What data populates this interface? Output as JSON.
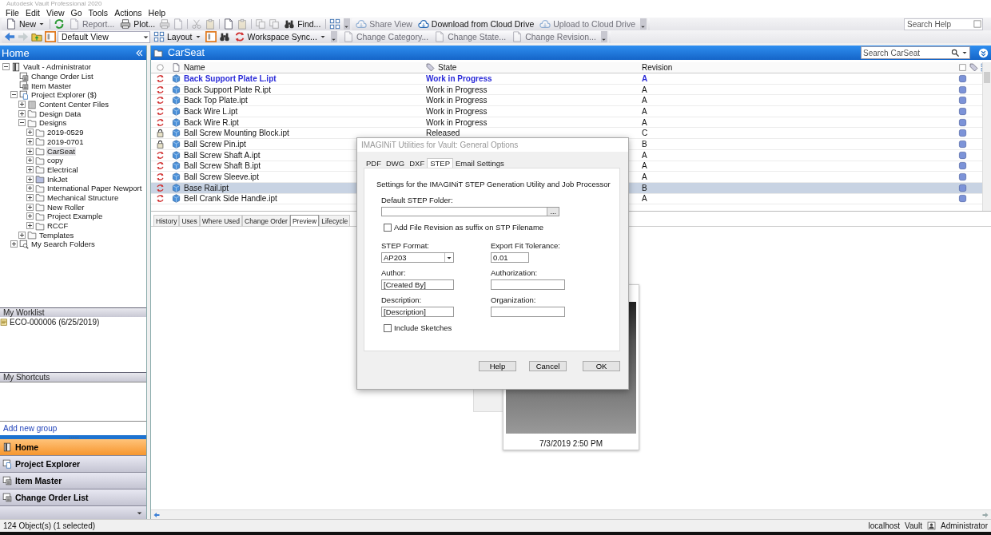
{
  "window": {
    "title": "Autodesk Vault Professional 2020"
  },
  "menu": [
    "File",
    "Edit",
    "View",
    "Go",
    "Tools",
    "Actions",
    "Help"
  ],
  "toolbar_1": [
    {
      "kind": "button",
      "label": "New",
      "dropdown": true,
      "disabled": false
    },
    {
      "kind": "sep"
    },
    {
      "kind": "icon",
      "disabled": false
    },
    {
      "kind": "button",
      "label": "Report...",
      "disabled": true
    },
    {
      "kind": "button",
      "label": "Plot...",
      "disabled": false
    },
    {
      "kind": "icon",
      "disabled": true
    },
    {
      "kind": "icon",
      "disabled": true
    },
    {
      "kind": "sep"
    },
    {
      "kind": "icon",
      "disabled": true
    },
    {
      "kind": "icon",
      "disabled": true
    },
    {
      "kind": "sep"
    },
    {
      "kind": "icon",
      "disabled": false
    },
    {
      "kind": "icon",
      "disabled": true
    },
    {
      "kind": "sep"
    },
    {
      "kind": "icon",
      "disabled": true
    },
    {
      "kind": "icon",
      "disabled": true
    },
    {
      "kind": "button",
      "label": "Find...",
      "disabled": false
    },
    {
      "kind": "sep"
    },
    {
      "kind": "icon",
      "disabled": false
    },
    {
      "kind": "end"
    },
    {
      "kind": "button",
      "label": "Share View",
      "disabled": true
    },
    {
      "kind": "button",
      "label": "Download from Cloud Drive",
      "disabled": false
    },
    {
      "kind": "button",
      "label": "Upload to Cloud Drive",
      "disabled": true
    },
    {
      "kind": "end"
    }
  ],
  "search_help": {
    "placeholder": "Search Help"
  },
  "toolbar_2": [
    {
      "kind": "icon",
      "disabled": false
    },
    {
      "kind": "icon",
      "disabled": true
    },
    {
      "kind": "icon",
      "disabled": false
    },
    {
      "kind": "icon",
      "disabled": false
    },
    {
      "kind": "combo",
      "label": "Default View"
    },
    {
      "kind": "button",
      "label": "Layout",
      "dropdown": true,
      "disabled": false
    },
    {
      "kind": "icon",
      "disabled": false
    },
    {
      "kind": "icon",
      "disabled": false
    },
    {
      "kind": "button",
      "label": "Workspace Sync...",
      "dropdown": true,
      "disabled": false
    },
    {
      "kind": "end"
    },
    {
      "kind": "button",
      "label": "Change Category...",
      "disabled": true
    },
    {
      "kind": "button",
      "label": "Change State...",
      "disabled": true
    },
    {
      "kind": "button",
      "label": "Change Revision...",
      "disabled": true
    },
    {
      "kind": "end"
    }
  ],
  "left_panel": {
    "title": "Home",
    "tree": [
      {
        "label": "Vault - Administrator",
        "expanded": true,
        "selected": false,
        "children": [
          {
            "label": "Change Order List",
            "selected": false
          },
          {
            "label": "Item Master",
            "selected": false
          },
          {
            "label": "Project Explorer ($)",
            "expanded": true,
            "selected": false,
            "children": [
              {
                "label": "Content Center Files",
                "expanded": false,
                "selected": false
              },
              {
                "label": "Design Data",
                "expanded": false,
                "selected": false
              },
              {
                "label": "Designs",
                "expanded": true,
                "selected": false,
                "children": [
                  {
                    "label": "2019-0529",
                    "expanded": false,
                    "selected": false
                  },
                  {
                    "label": "2019-0701",
                    "expanded": false,
                    "selected": false
                  },
                  {
                    "label": "CarSeat",
                    "expanded": false,
                    "selected": true
                  },
                  {
                    "label": "copy",
                    "expanded": false,
                    "selected": false
                  },
                  {
                    "label": "Electrical",
                    "expanded": false,
                    "selected": false
                  },
                  {
                    "label": "InkJet",
                    "expanded": false,
                    "selected": false
                  },
                  {
                    "label": "International Paper Newport",
                    "expanded": false,
                    "selected": false
                  },
                  {
                    "label": "Mechanical Structure",
                    "expanded": false,
                    "selected": false
                  },
                  {
                    "label": "New Roller",
                    "expanded": false,
                    "selected": false
                  },
                  {
                    "label": "Project Example",
                    "expanded": false,
                    "selected": false
                  },
                  {
                    "label": "RCCF",
                    "expanded": false,
                    "selected": false
                  }
                ]
              },
              {
                "label": "Templates",
                "expanded": false,
                "selected": false
              }
            ]
          },
          {
            "label": "My Search Folders",
            "expanded": false,
            "selected": false
          }
        ]
      }
    ],
    "worklist": {
      "title": "My Worklist",
      "items": [
        "ECO-000006 (6/25/2019)"
      ]
    },
    "shortcuts": {
      "title": "My Shortcuts",
      "action": "Add new group"
    },
    "nav": [
      {
        "label": "Home",
        "selected": true
      },
      {
        "label": "Project Explorer",
        "selected": false
      },
      {
        "label": "Item Master",
        "selected": false
      },
      {
        "label": "Change Order List",
        "selected": false
      }
    ]
  },
  "main": {
    "title": "CarSeat",
    "search": {
      "placeholder": "Search CarSeat"
    },
    "columns": [
      "Name",
      "State",
      "Revision"
    ],
    "rows": [
      {
        "locked": false,
        "name": "Back Support Plate L.ipt",
        "state": "Work in Progress",
        "revision": "A",
        "emphasis": true,
        "selected": false
      },
      {
        "locked": false,
        "name": "Back Support Plate R.ipt",
        "state": "Work in Progress",
        "revision": "A",
        "emphasis": false,
        "selected": false
      },
      {
        "locked": false,
        "name": "Back Top Plate.ipt",
        "state": "Work in Progress",
        "revision": "A",
        "emphasis": false,
        "selected": false
      },
      {
        "locked": false,
        "name": "Back Wire L.ipt",
        "state": "Work in Progress",
        "revision": "A",
        "emphasis": false,
        "selected": false
      },
      {
        "locked": false,
        "name": "Back Wire R.ipt",
        "state": "Work in Progress",
        "revision": "A",
        "emphasis": false,
        "selected": false
      },
      {
        "locked": true,
        "name": "Ball Screw Mounting Block.ipt",
        "state": "Released",
        "revision": "C",
        "emphasis": false,
        "selected": false
      },
      {
        "locked": true,
        "name": "Ball Screw Pin.ipt",
        "revision": "B",
        "emphasis": false,
        "selected": false
      },
      {
        "locked": false,
        "name": "Ball Screw Shaft A.ipt",
        "revision": "A",
        "emphasis": false,
        "selected": false
      },
      {
        "locked": false,
        "name": "Ball Screw Shaft B.ipt",
        "revision": "A",
        "emphasis": false,
        "selected": false
      },
      {
        "locked": false,
        "name": "Ball Screw Sleeve.ipt",
        "revision": "A",
        "emphasis": false,
        "selected": false
      },
      {
        "locked": false,
        "name": "Base Rail.ipt",
        "revision": "B",
        "emphasis": false,
        "selected": true
      },
      {
        "locked": false,
        "name": "Bell Crank Side Handle.ipt",
        "revision": "A",
        "emphasis": false,
        "selected": false
      }
    ],
    "tabs": [
      {
        "label": "History",
        "selected": false
      },
      {
        "label": "Uses",
        "selected": false
      },
      {
        "label": "Where Used",
        "selected": false
      },
      {
        "label": "Change Order",
        "selected": false
      },
      {
        "label": "Preview",
        "selected": true
      },
      {
        "label": "Lifecycle",
        "selected": false
      }
    ],
    "preview": {
      "date": "7/3/2019 2:50 PM"
    }
  },
  "dialog": {
    "title": "IMAGINiT Utilities for Vault: General Options",
    "tabs": [
      {
        "label": "PDF",
        "selected": false
      },
      {
        "label": "DWG",
        "selected": false
      },
      {
        "label": "DXF",
        "selected": false
      },
      {
        "label": "STEP",
        "selected": true
      },
      {
        "label": "Email Settings",
        "selected": false
      }
    ],
    "intro": "Settings for the IMAGINiT STEP Generation Utility and Job Processor",
    "folder": {
      "label": "Default STEP Folder:",
      "browse": "..."
    },
    "suffix_checkbox": {
      "label": "Add File Revision as suffix on STP Filename",
      "checked": false
    },
    "fields": [
      {
        "label": "STEP Format:",
        "kind": "dropdown",
        "value": "AP203"
      },
      {
        "label": "Export Fit Tolerance:",
        "kind": "text",
        "value": "0.01"
      },
      {
        "label": "Author:",
        "kind": "text",
        "value": "[Created By]"
      },
      {
        "label": "Authorization:",
        "kind": "text"
      },
      {
        "label": "Description:",
        "kind": "text",
        "value": "[Description]"
      },
      {
        "label": "Organization:",
        "kind": "text"
      }
    ],
    "sketches_checkbox": {
      "label": "Include Sketches",
      "checked": false
    },
    "buttons": [
      "Help",
      "Cancel",
      "OK"
    ]
  },
  "status_bar": {
    "text": "124 Object(s) (1 selected)",
    "server": "localhost",
    "vault": "Vault",
    "user": "Administrator"
  }
}
